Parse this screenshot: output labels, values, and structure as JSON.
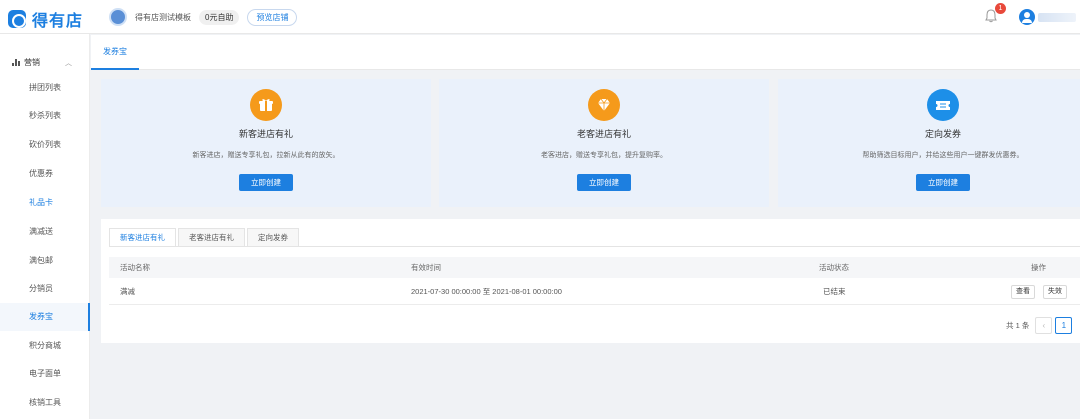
{
  "header": {
    "logo_text": "得有店",
    "shop_name": "得有店测试模板",
    "plan_badge": "0元自助",
    "preview_button": "预览店铺",
    "notification_count": "1"
  },
  "sidebar": {
    "group_label": "营销",
    "items": [
      {
        "label": "拼团列表"
      },
      {
        "label": "秒杀列表"
      },
      {
        "label": "砍价列表"
      },
      {
        "label": "优惠券"
      },
      {
        "label": "礼品卡"
      },
      {
        "label": "满减送"
      },
      {
        "label": "满包邮"
      },
      {
        "label": "分销员"
      },
      {
        "label": "发券宝"
      },
      {
        "label": "积分商城"
      },
      {
        "label": "电子面单"
      },
      {
        "label": "核销工具"
      }
    ]
  },
  "subnav": {
    "tab": "发券宝"
  },
  "cards": [
    {
      "title": "新客进店有礼",
      "desc": "新客进店，赠送专享礼包，拉新从此有的放矢。",
      "button": "立即创建",
      "color": "#f59a1b",
      "icon": "gift-icon"
    },
    {
      "title": "老客进店有礼",
      "desc": "老客进店，赠送专享礼包，提升复购率。",
      "button": "立即创建",
      "color": "#f59a1b",
      "icon": "diamond-icon"
    },
    {
      "title": "定向发券",
      "desc": "帮助筛选目标用户，并给这些用户一键群发优惠券。",
      "button": "立即创建",
      "color": "#1d8fe8",
      "icon": "ticket-icon"
    }
  ],
  "tabs": [
    "新客进店有礼",
    "老客进店有礼",
    "定向发券"
  ],
  "table": {
    "headers": [
      "活动名称",
      "有效时间",
      "活动状态",
      "操作"
    ],
    "rows": [
      {
        "name": "满减",
        "time": "2021-07-30 00:00:00 至 2021-08-01 00:00:00",
        "status": "已结束",
        "actions": [
          "查看",
          "失效"
        ]
      }
    ]
  },
  "pager": {
    "total": "共 1 条",
    "prev": "‹",
    "page": "1"
  },
  "colors": {
    "accent": "#1d7fe0"
  }
}
